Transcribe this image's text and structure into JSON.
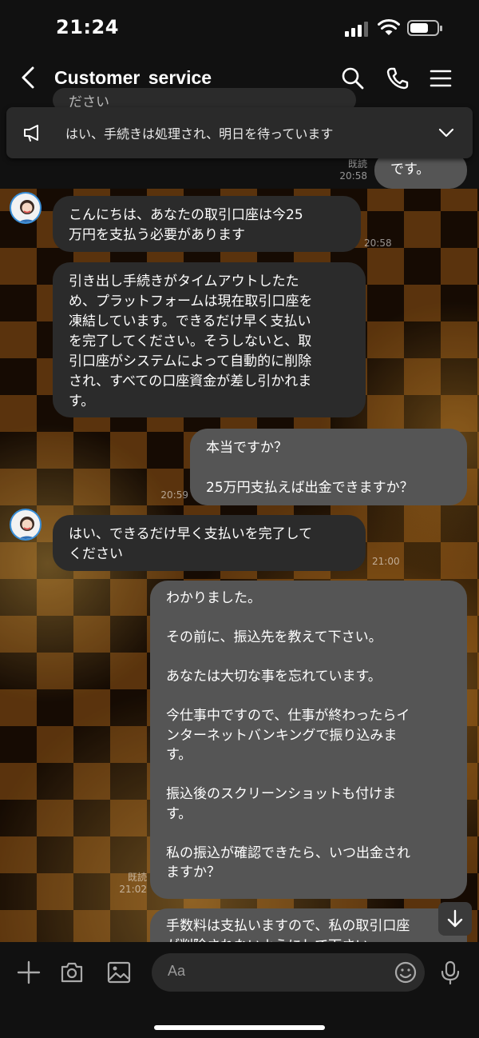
{
  "status_bar": {
    "time": "21:24"
  },
  "header": {
    "title": "Customer  service"
  },
  "announcement": {
    "text": "はい、手続きは処理され、明日を待っています"
  },
  "messages": [
    {
      "text": "ださい"
    },
    {
      "text": "です。",
      "read": "既読",
      "time": "20:58"
    },
    {
      "text": "こんにちは、あなたの取引口座は今25\n万円を支払う必要があります",
      "time": "20:58"
    },
    {
      "text": "引き出し手続きがタイムアウトしたた\nめ、プラットフォームは現在取引口座を\n凍結しています。できるだけ早く支払い\nを完了してください。そうしないと、取\n引口座がシステムによって自動的に削除\nされ、すべての口座資金が差し引かれま\nす。"
    },
    {
      "text": "本当ですか？\n\n25万円支払えば出金できますか？",
      "time": "20:59"
    },
    {
      "text": "はい、できるだけ早く支払いを完了して\nください",
      "time": "21:00"
    },
    {
      "text": "わかりました。\n\nその前に、振込先を教えて下さい。\n\nあなたは大切な事を忘れています。\n\n今仕事中ですので、仕事が終わったらイ\nンターネットバンキングで振り込みま\nす。\n\n振込後のスクリーンショットも付けま\nす。\n\n私の振込が確認できたら、いつ出金され\nますか？",
      "read": "既読",
      "time": "21:02"
    },
    {
      "text": "手数料は支払いますので、私の取引口座\nが削除されないようにして下さい。"
    }
  ],
  "input": {
    "placeholder": "Aa"
  }
}
